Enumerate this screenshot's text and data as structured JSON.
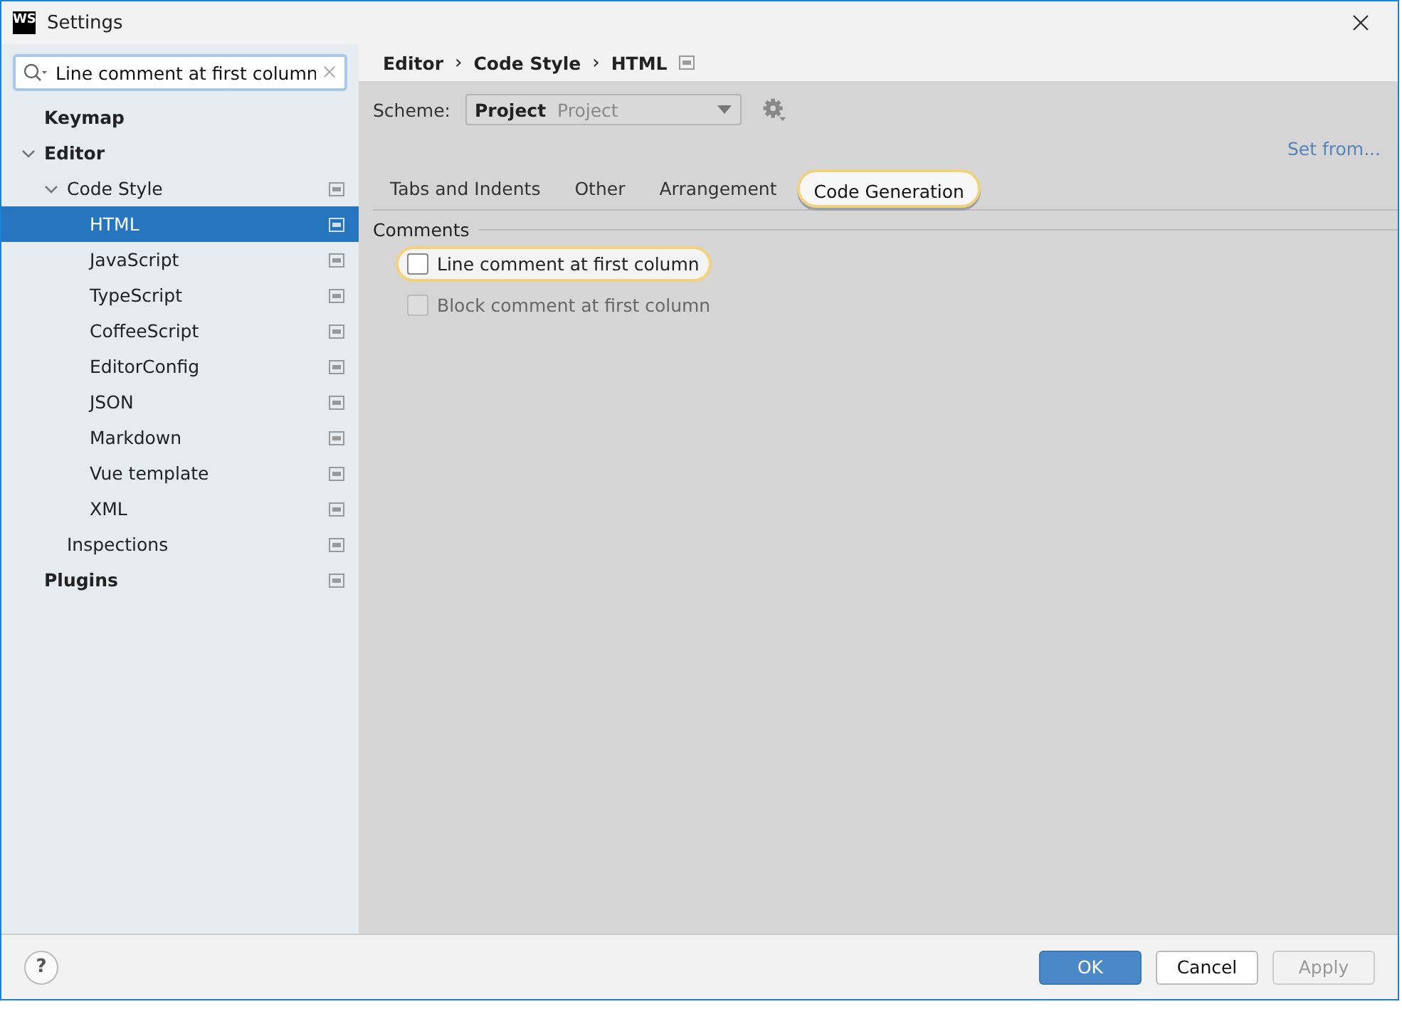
{
  "window": {
    "title": "Settings",
    "logo": "WS"
  },
  "search": {
    "value": "Line comment at first column"
  },
  "tree": [
    {
      "label": "Keymap",
      "selected": false,
      "scoped": false
    },
    {
      "label": "Editor",
      "selected": false,
      "scoped": false,
      "expanded": true,
      "children": [
        {
          "label": "Code Style",
          "selected": false,
          "scoped": true,
          "expanded": true,
          "children": [
            {
              "label": "HTML",
              "selected": true,
              "scoped": true
            },
            {
              "label": "JavaScript",
              "selected": false,
              "scoped": true
            },
            {
              "label": "TypeScript",
              "selected": false,
              "scoped": true
            },
            {
              "label": "CoffeeScript",
              "selected": false,
              "scoped": true
            },
            {
              "label": "EditorConfig",
              "selected": false,
              "scoped": true
            },
            {
              "label": "JSON",
              "selected": false,
              "scoped": true
            },
            {
              "label": "Markdown",
              "selected": false,
              "scoped": true
            },
            {
              "label": "Vue template",
              "selected": false,
              "scoped": true
            },
            {
              "label": "XML",
              "selected": false,
              "scoped": true
            }
          ]
        },
        {
          "label": "Inspections",
          "selected": false,
          "scoped": true
        }
      ]
    },
    {
      "label": "Plugins",
      "selected": false,
      "scoped": true
    }
  ],
  "breadcrumb": [
    "Editor",
    "Code Style",
    "HTML"
  ],
  "breadcrumb_separator": "›",
  "help": "?",
  "scheme": {
    "label": "Scheme:",
    "name": "Project",
    "scope": "Project"
  },
  "set_from": "Set from...",
  "tabs": [
    {
      "label": "Tabs and Indents",
      "selected": false
    },
    {
      "label": "Other",
      "selected": false
    },
    {
      "label": "Arrangement",
      "selected": false
    },
    {
      "label": "Code Generation",
      "selected": true
    }
  ],
  "section": "Comments",
  "options": [
    {
      "label": "Line comment at first column",
      "checked": false,
      "highlighted": true,
      "disabled": false
    },
    {
      "label": "Block comment at first column",
      "checked": false,
      "highlighted": false,
      "disabled": true
    }
  ],
  "buttons": [
    {
      "label": "OK",
      "kind": "primary",
      "disabled": false
    },
    {
      "label": "Cancel",
      "kind": "normal",
      "disabled": false
    },
    {
      "label": "Apply",
      "kind": "normal",
      "disabled": true
    }
  ]
}
